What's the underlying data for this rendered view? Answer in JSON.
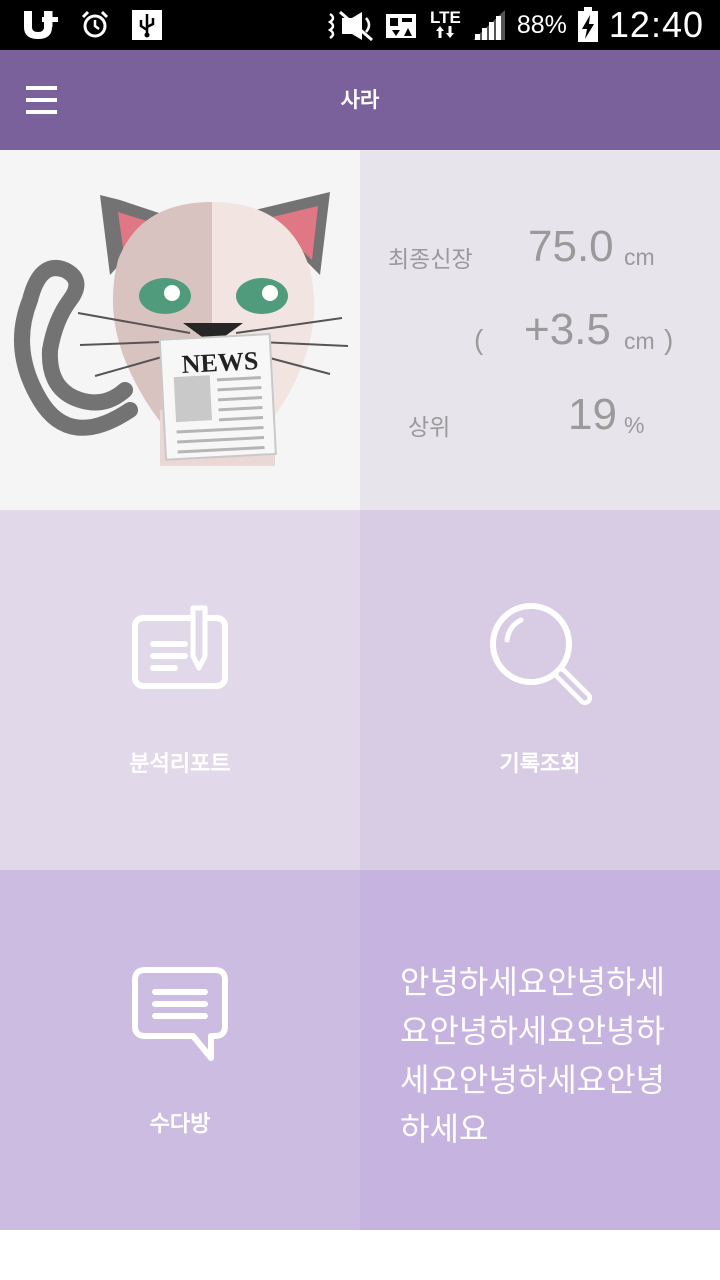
{
  "status_bar": {
    "icons_left": [
      "u-plus-icon",
      "alarm-icon",
      "usb-icon"
    ],
    "icons_right": [
      "mute-icon",
      "data-saver-icon",
      "lte-icon",
      "signal-icon",
      "battery-charging-icon"
    ],
    "lte_label": "LTE",
    "battery_percent": "88%",
    "time": "12:40"
  },
  "app_bar": {
    "title": "사라",
    "menu_icon": "hamburger-menu-icon",
    "color": "#7a619b"
  },
  "cat_tile": {
    "newspaper_label": "NEWS"
  },
  "stats": {
    "final_height_label": "최종신장",
    "final_height_value": "75.0",
    "final_height_unit": "cm",
    "paren_open": "(",
    "growth_value": "+3.5",
    "growth_unit": "cm",
    "paren_close": ")",
    "rank_label": "상위",
    "rank_value": "19",
    "rank_unit": "%"
  },
  "menu_tiles": {
    "report_label": "분석리포트",
    "report_icon": "edit-document-icon",
    "history_label": "기록조회",
    "history_icon": "search-icon",
    "chat_label": "수다방",
    "chat_icon": "chat-bubble-icon"
  },
  "greeting": {
    "text": "안녕하세요안녕하세요안녕하세요안녕하세요안녕하세요안녕하세요"
  },
  "colors": {
    "tile_report": "#e1d9e9",
    "tile_history": "#d8cce5",
    "tile_chat": "#cdbce1",
    "tile_greeting": "#c6b3e0",
    "tile_stats": "#e7e4ec"
  }
}
